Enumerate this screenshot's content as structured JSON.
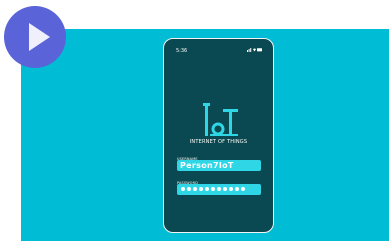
{
  "colors": {
    "accent": "#00bcd4",
    "phone_background": "#0a4951",
    "field_background": "#2fd6e6",
    "play_button": "#5a63d8"
  },
  "video": {
    "play_icon": "play-icon"
  },
  "phone": {
    "status_bar": {
      "time": "5:36",
      "icons": "signal-wifi-battery-icons"
    },
    "brand": {
      "logo_text": "IoT",
      "title": "INTERNET OF THINGS"
    },
    "form": {
      "username_label": "USERNAME",
      "username_value": "Person7IoT",
      "password_label": "PASSWORD",
      "password_mask": "●●●●●●●●●●●"
    }
  }
}
